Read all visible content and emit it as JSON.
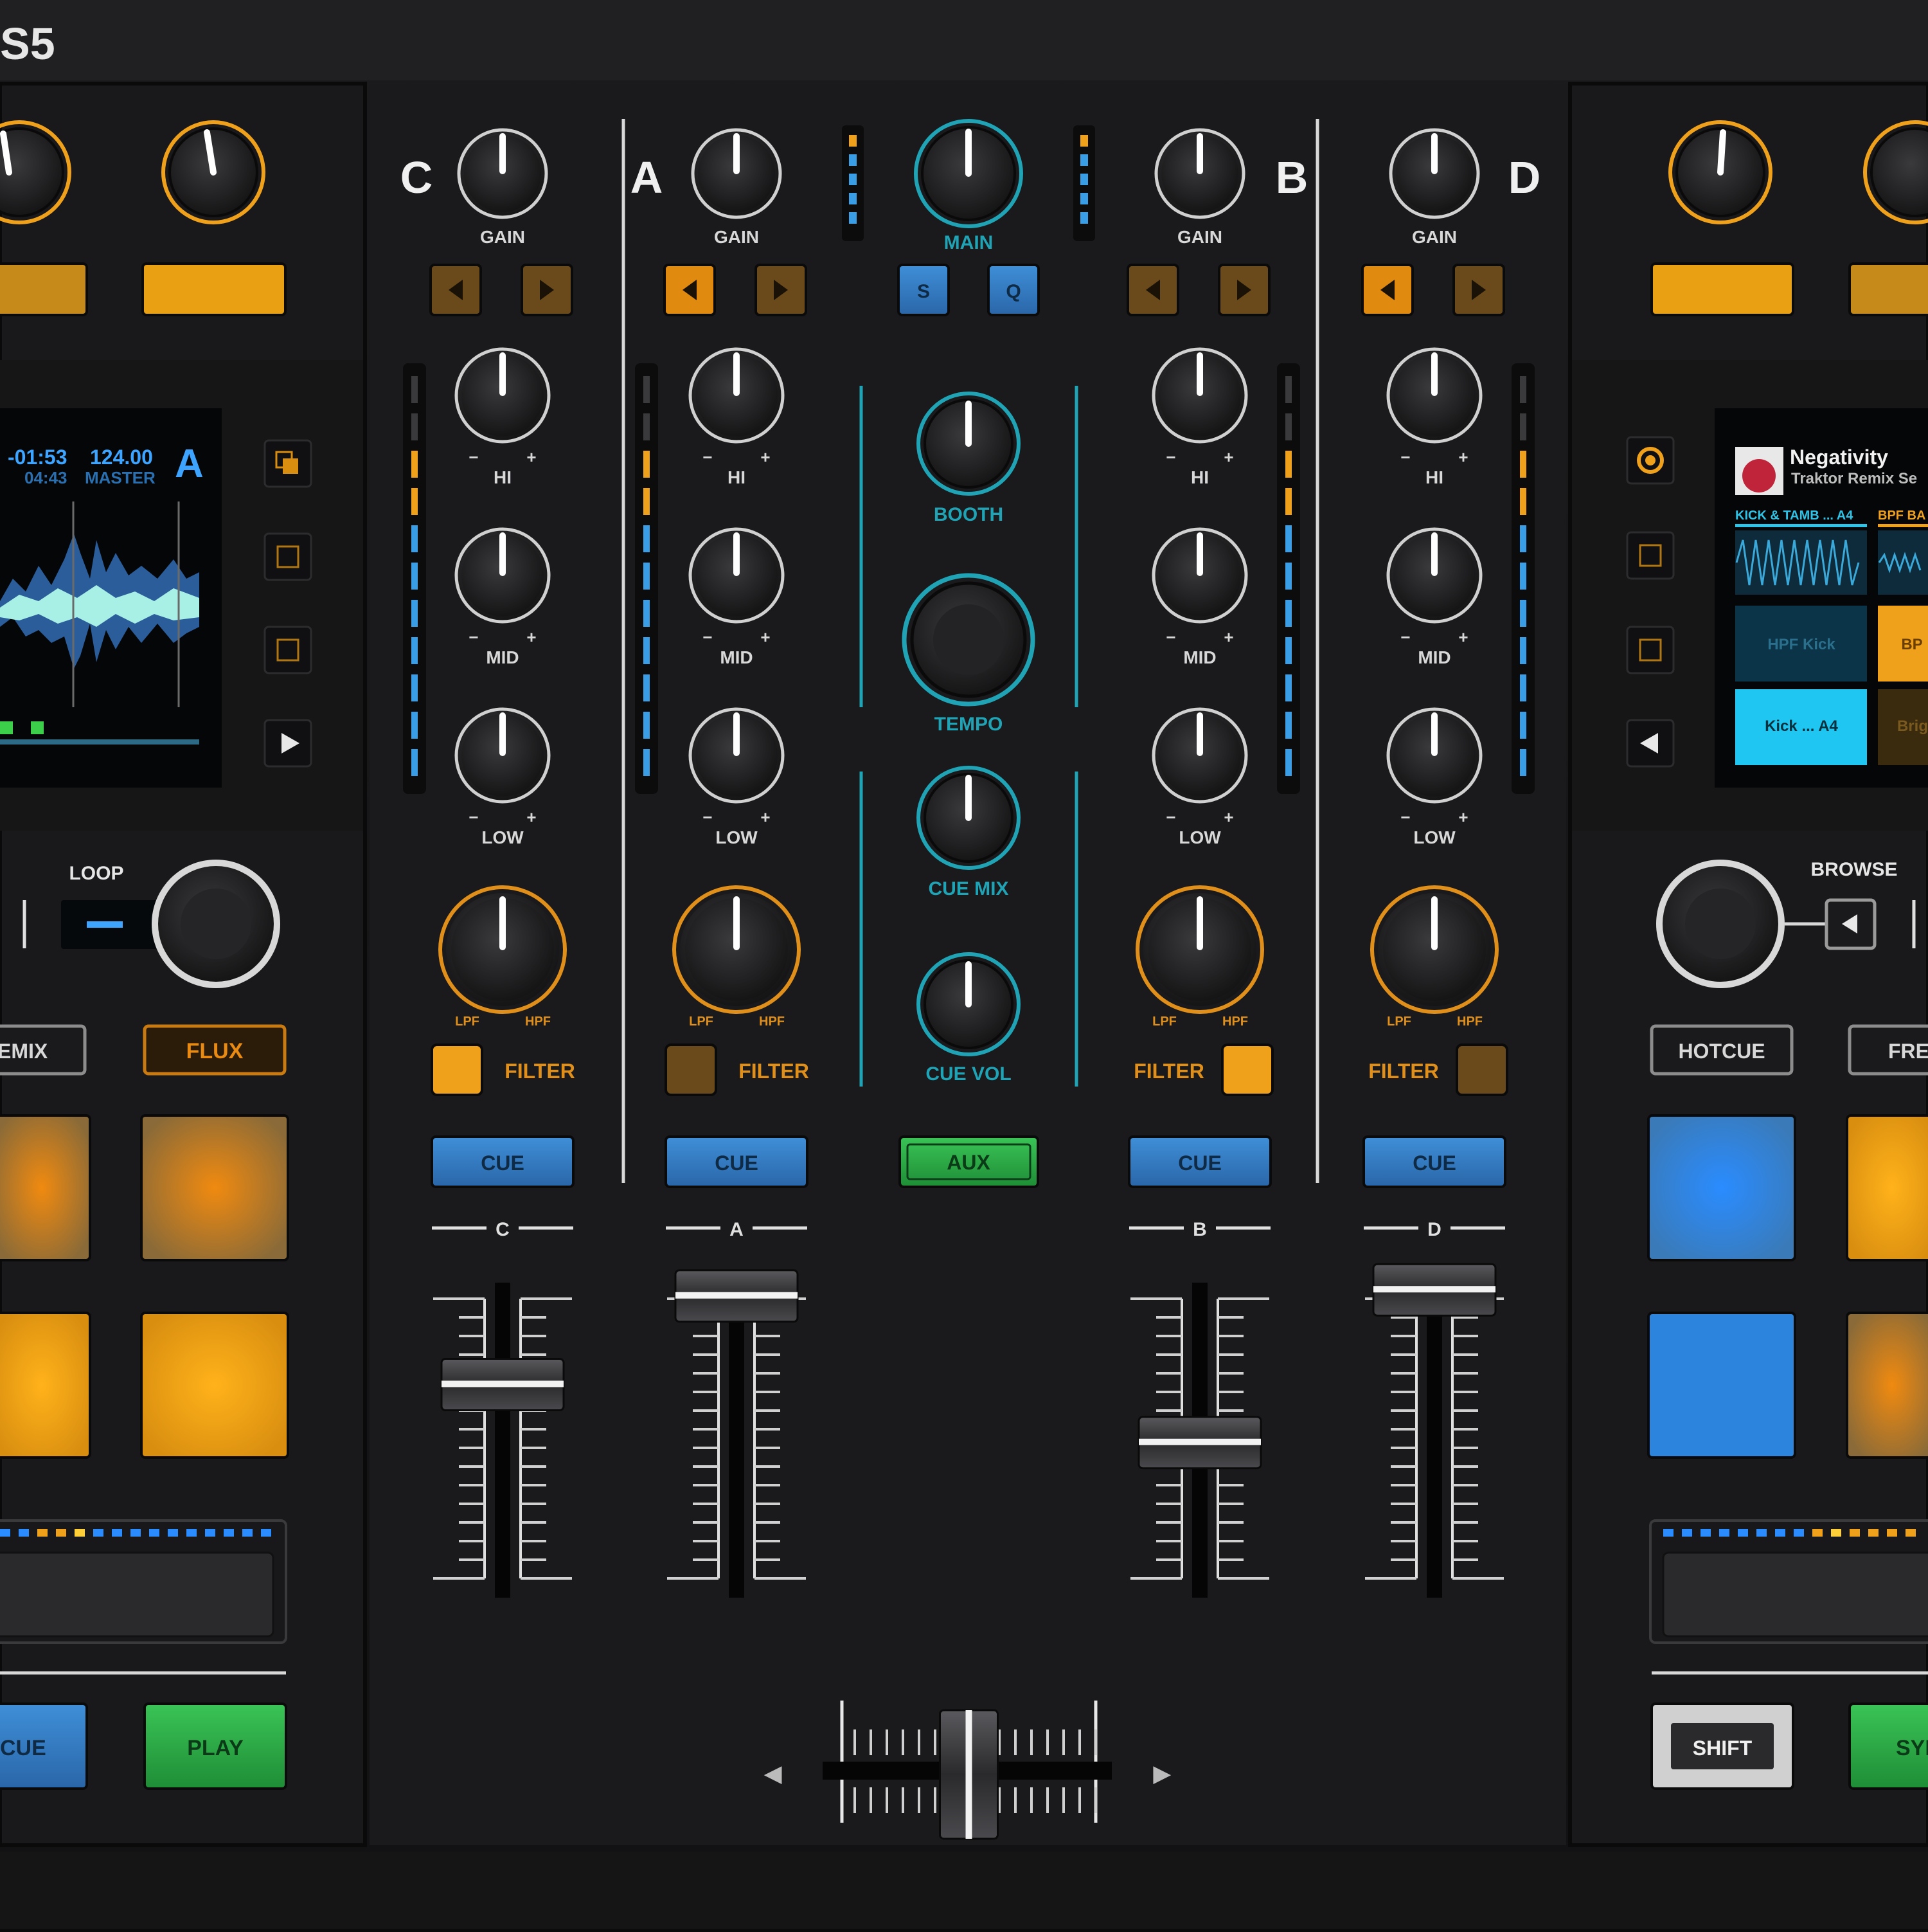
{
  "title_fragment": "S5",
  "channels": [
    {
      "letter": "C",
      "gain_label": "GAIN",
      "hi_label": "HI",
      "mid_label": "MID",
      "low_label": "LOW",
      "lpf": "LPF",
      "hpf": "HPF",
      "filter_label": "FILTER",
      "cue_label": "CUE",
      "fader_label": "C",
      "fader_level": 0.66,
      "filter_on": true
    },
    {
      "letter": "A",
      "gain_label": "GAIN",
      "hi_label": "HI",
      "mid_label": "MID",
      "low_label": "LOW",
      "lpf": "LPF",
      "hpf": "HPF",
      "filter_label": "FILTER",
      "cue_label": "CUE",
      "fader_label": "A",
      "fader_level": 0.95,
      "filter_on": false
    },
    {
      "letter": "B",
      "gain_label": "GAIN",
      "hi_label": "HI",
      "mid_label": "MID",
      "low_label": "LOW",
      "lpf": "LPF",
      "hpf": "HPF",
      "filter_label": "FILTER",
      "cue_label": "CUE",
      "fader_label": "B",
      "fader_level": 0.47,
      "filter_on": true
    },
    {
      "letter": "D",
      "gain_label": "GAIN",
      "hi_label": "HI",
      "mid_label": "MID",
      "low_label": "LOW",
      "lpf": "LPF",
      "hpf": "HPF",
      "filter_label": "FILTER",
      "cue_label": "CUE",
      "fader_label": "D",
      "fader_level": 0.97,
      "filter_on": false
    }
  ],
  "center": {
    "main_label": "MAIN",
    "s_label": "S",
    "q_label": "Q",
    "booth_label": "BOOTH",
    "tempo_label": "TEMPO",
    "cue_mix_label": "CUE MIX",
    "cue_vol_label": "CUE VOL",
    "aux_label": "AUX",
    "crossfader_position": 0.5
  },
  "left_deck": {
    "time_remaining": "-01:53",
    "bpm": "124.00",
    "deck_letter": "A",
    "time_total": "04:43",
    "tempo_mode": "MASTER",
    "loop_label": "LOOP",
    "remix_label": "EMIX",
    "flux_label": "FLUX",
    "cue_label": "CUE",
    "play_label": "PLAY"
  },
  "right_deck": {
    "track_title": "Negativity",
    "track_artist": "Traktor Remix Se",
    "slot1_name": "KICK & TAMB ... A4",
    "slot2_name": "BPF BA",
    "cell_hpf": "HPF Kick",
    "cell_bp": "BP",
    "cell_kick": "Kick ... A4",
    "cell_brig": "Brig",
    "browse_label": "BROWSE",
    "hotcue_label": "HOTCUE",
    "free_label": "FREE",
    "shift_label": "SHIFT",
    "sync_label": "SYN"
  },
  "colors": {
    "orange": "#f0a11c",
    "blue": "#3a8fe0",
    "teal": "#1fa3b5",
    "green": "#2fae46",
    "panel": "#1c1c1e"
  }
}
